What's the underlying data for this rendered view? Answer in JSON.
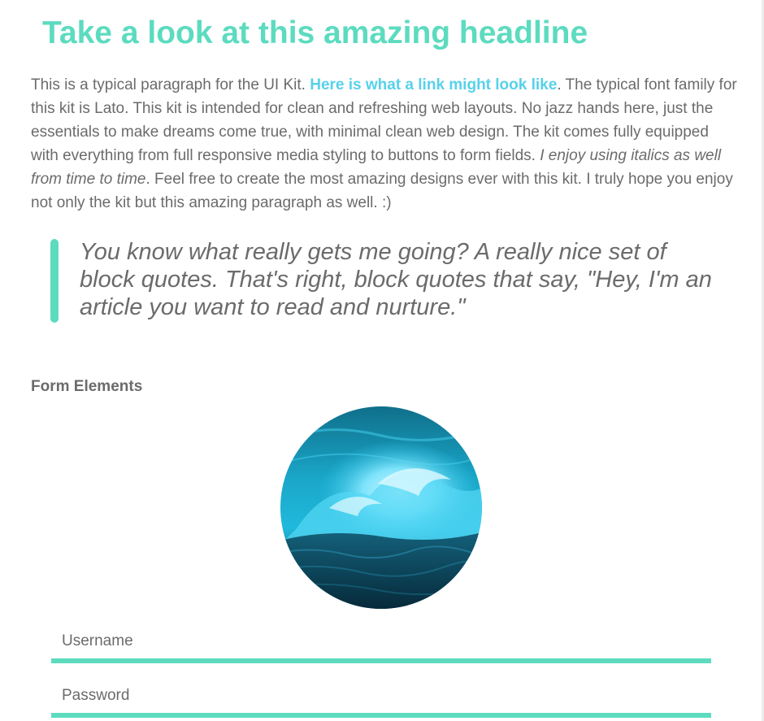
{
  "headline": "Take a look at this amazing headline",
  "paragraph": {
    "intro": "This is a typical paragraph for the UI Kit. ",
    "link_text": "Here is what a link might look like",
    "middle": ". The typical font family for this kit is Lato. This kit is intended for clean and refreshing web layouts. No jazz hands here, just the essentials to make dreams come true, with minimal clean web design. The kit comes fully equipped with everything from full responsive media styling to buttons to form fields. ",
    "italic": "I enjoy using italics as well from time to time",
    "outro": ". Feel free to create the most amazing designs ever with this kit. I truly hope you enjoy not only the kit but this amazing paragraph as well. :)"
  },
  "blockquote": "You know what really gets me going? A really nice set of block quotes. That's right, block quotes that say, \"Hey, I'm an article you want to read and nurture.\"",
  "form": {
    "section_label": "Form Elements",
    "avatar_icon": "ocean-wave-image",
    "username_placeholder": "Username",
    "password_placeholder": "Password"
  },
  "colors": {
    "accent_green": "#5cdbbf",
    "link_blue": "#57d1eb",
    "body_text": "#6b6b6b"
  }
}
